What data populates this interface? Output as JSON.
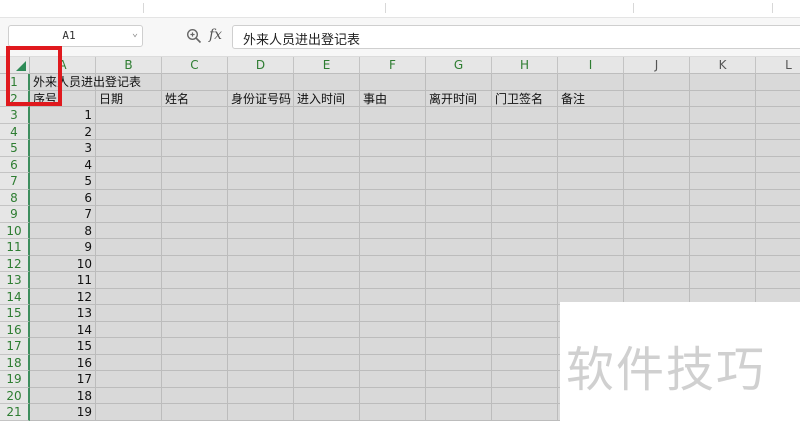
{
  "formula_bar": {
    "name_box": "A1",
    "zoom_icon": "zoom-icon",
    "fx_label": "fx",
    "formula_value": "外来人员进出登记表"
  },
  "columns": [
    "A",
    "B",
    "C",
    "D",
    "E",
    "F",
    "G",
    "H",
    "I",
    "J",
    "K",
    "L"
  ],
  "rows": [
    "1",
    "2",
    "3",
    "4",
    "5",
    "6",
    "7",
    "8",
    "9",
    "10",
    "11",
    "12",
    "13",
    "14",
    "15",
    "16",
    "17",
    "18",
    "19",
    "20",
    "21"
  ],
  "sheet": {
    "title": "外来人员进出登记表",
    "headers": [
      "序号",
      "日期",
      "姓名",
      "身份证号码",
      "进入时间",
      "事由",
      "离开时间",
      "门卫签名",
      "备注"
    ],
    "serials": [
      "1",
      "2",
      "3",
      "4",
      "5",
      "6",
      "7",
      "8",
      "9",
      "10",
      "11",
      "12",
      "13",
      "14",
      "15",
      "16",
      "17",
      "18",
      "19"
    ]
  },
  "watermark": "软件技巧",
  "colors": {
    "accent": "#2e7d32",
    "highlight": "#e0191e",
    "grid_fill": "#d9d9d9"
  }
}
